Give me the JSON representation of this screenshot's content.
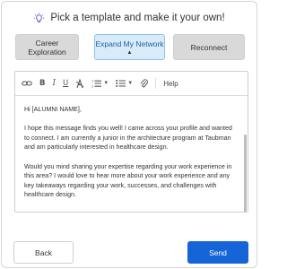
{
  "header": {
    "title": "Pick a template and make it your own!",
    "icon": "lightbulb-icon",
    "icon_color": "#6a4fd6"
  },
  "templates": [
    {
      "label": "Career Exploration",
      "selected": false
    },
    {
      "label": "Expand My Network",
      "selected": true
    },
    {
      "label": "Reconnect",
      "selected": false
    }
  ],
  "toolbar": {
    "bold_label": "B",
    "italic_label": "I",
    "underline_label": "U",
    "help_label": "Help",
    "icons": [
      "link-icon",
      "bold-icon",
      "italic-icon",
      "underline-icon",
      "clear-format-icon",
      "numbered-list-icon",
      "bullet-list-icon",
      "attachment-icon",
      "help-icon"
    ]
  },
  "message": {
    "greeting": "Hi [ALUMNI NAME],",
    "paragraph1": "I hope this message finds you well! I came across your profile and wanted to connect. I am currently a junior in the architecture program at Taubman and am particularly interested in healthcare design.",
    "paragraph2": "Would you mind sharing your expertise regarding your work experience in this area? I would love to hear more about your work experience and any key takeaways regarding your work, successes, and challenges with healthcare design."
  },
  "actions": {
    "back_label": "Back",
    "send_label": "Send"
  },
  "colors": {
    "accent": "#1565d8",
    "selected_bg": "#d8ebfb",
    "selected_border": "#8cc3ee"
  }
}
